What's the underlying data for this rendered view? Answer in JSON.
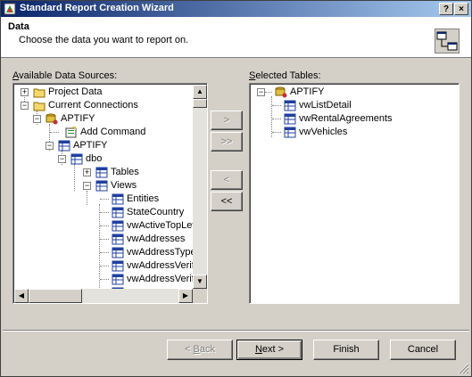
{
  "window": {
    "title": "Standard Report Creation Wizard",
    "help_label": "?",
    "close_label": "×"
  },
  "header": {
    "title": "Data",
    "subtitle": "Choose the data you want to report on."
  },
  "available": {
    "label_accel": "A",
    "label_rest": "vailable Data Sources:",
    "items": [
      {
        "label": "Project Data"
      },
      {
        "label": "Current Connections"
      },
      {
        "label": "APTIFY"
      },
      {
        "label": "Add Command"
      },
      {
        "label": "APTIFY"
      },
      {
        "label": "dbo"
      },
      {
        "label": "Tables"
      },
      {
        "label": "Views"
      },
      {
        "label": "Entities"
      },
      {
        "label": "StateCountry"
      },
      {
        "label": "vwActiveTopLev"
      },
      {
        "label": "vwAddresses"
      },
      {
        "label": "vwAddressTypes"
      },
      {
        "label": "vwAddressVerific"
      },
      {
        "label": "vwAddressVerific"
      }
    ]
  },
  "selected": {
    "label_accel": "S",
    "label_rest": "elected Tables:",
    "items": [
      {
        "label": "APTIFY"
      },
      {
        "label": "vwListDetail"
      },
      {
        "label": "vwRentalAgreements"
      },
      {
        "label": "vwVehicles"
      }
    ]
  },
  "transfer": {
    "add": ">",
    "add_all": ">>",
    "remove": "<",
    "remove_all": "<<"
  },
  "footer": {
    "back_pre": "< ",
    "back_accel": "B",
    "back_rest": "ack",
    "next_accel": "N",
    "next_rest": "ext >",
    "finish": "Finish",
    "cancel": "Cancel"
  },
  "colors": {
    "titlebar_start": "#0a246a",
    "titlebar_end": "#a6caf0",
    "face": "#d4d0c8"
  }
}
